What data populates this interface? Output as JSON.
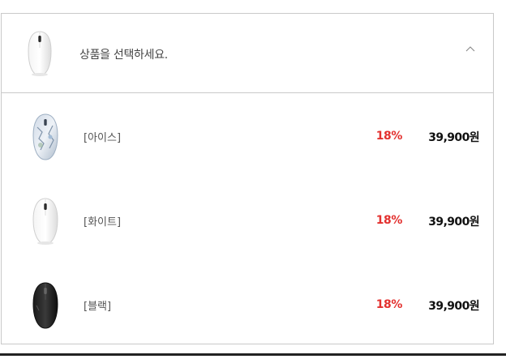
{
  "select": {
    "placeholder": "상품을 선택하세요.",
    "header_icon": "chevron-up-icon",
    "options": [
      {
        "name": "[아이스]",
        "discount": "18%",
        "price": "39,900원",
        "thumb": "ice-mouse"
      },
      {
        "name": "[화이트]",
        "discount": "18%",
        "price": "39,900원",
        "thumb": "white-mouse"
      },
      {
        "name": "[블랙]",
        "discount": "18%",
        "price": "39,900원",
        "thumb": "black-mouse"
      }
    ]
  },
  "colors": {
    "discount": "#e3312f",
    "border": "#c9c9c9",
    "price": "#111111"
  }
}
